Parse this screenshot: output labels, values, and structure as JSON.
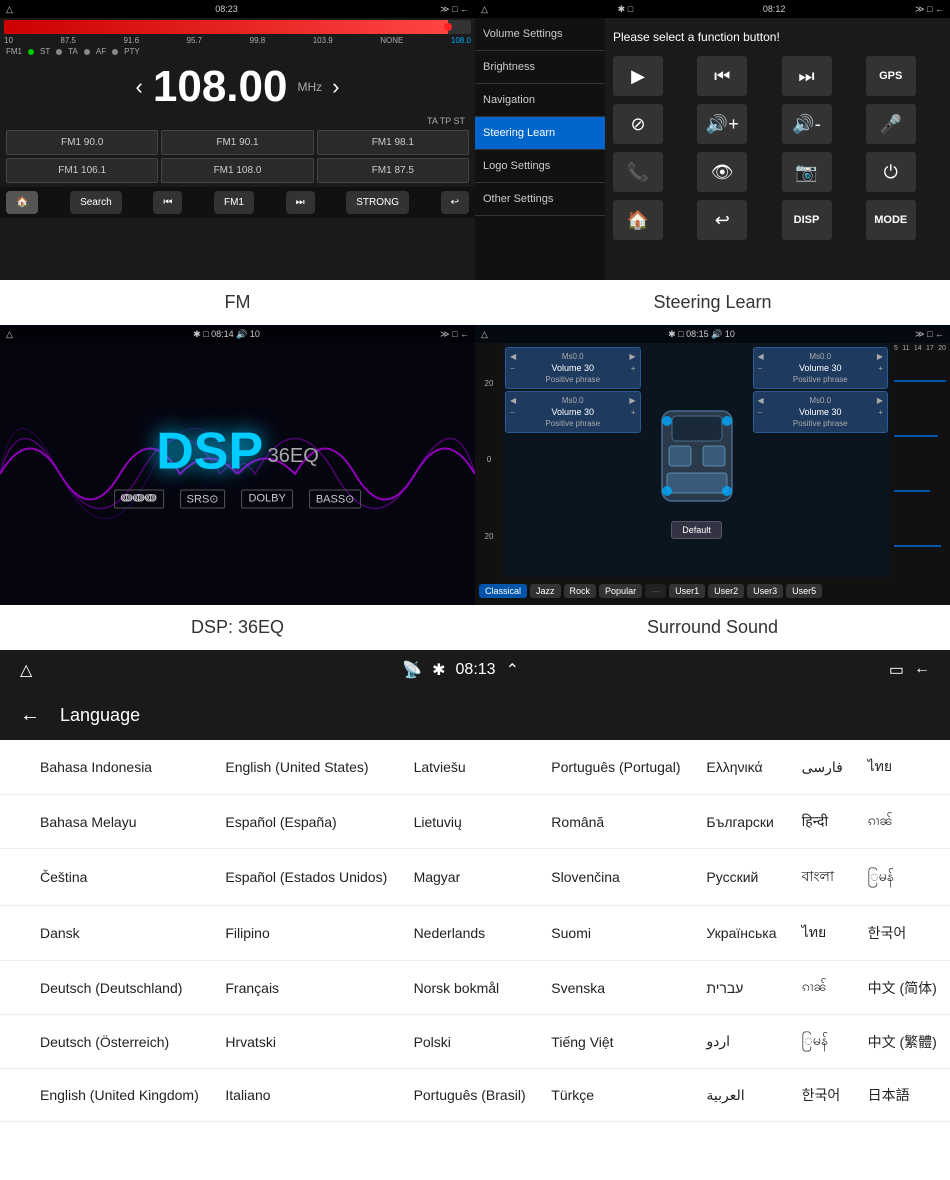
{
  "fm": {
    "status_bar": {
      "left": "△",
      "time": "08:23",
      "icons": "≫ □ ←"
    },
    "progress": 95,
    "scale": [
      "10",
      "87.5",
      "91.6",
      "95.7",
      "99.8",
      "103.9",
      "NONE",
      "108.0"
    ],
    "indicators": [
      "ST",
      "TA",
      "AF",
      "PTY"
    ],
    "fm_label": "FM1",
    "frequency": "108.00",
    "unit": "MHz",
    "ta_tp": "TA  TP  ST",
    "presets": [
      "FM1 90.0",
      "FM1 90.1",
      "FM1 98.1",
      "FM1 106.1",
      "FM1 108.0",
      "FM1 87.5"
    ],
    "buttons": [
      "🏠",
      "Search",
      "⏮",
      "FM1",
      "⏭",
      "STRONG",
      "↩"
    ]
  },
  "steering": {
    "status_bar": {
      "time": "08:12"
    },
    "header_text": "Please select a function button!",
    "sidebar_items": [
      "Volume Settings",
      "Brightness",
      "Navigation",
      "Steering Learn",
      "Logo Settings",
      "Other Settings"
    ],
    "active_sidebar": "Steering Learn",
    "buttons": [
      {
        "icon": "▶",
        "label": "play"
      },
      {
        "icon": "⏮",
        "label": "prev"
      },
      {
        "icon": "⏭",
        "label": "next"
      },
      {
        "icon": "GPS",
        "label": "gps"
      },
      {
        "icon": "⊘",
        "label": "no"
      },
      {
        "icon": "🔊+",
        "label": "vol-up"
      },
      {
        "icon": "🔊-",
        "label": "vol-down"
      },
      {
        "icon": "🎤",
        "label": "mic"
      },
      {
        "icon": "📞",
        "label": "call"
      },
      {
        "icon": "👁",
        "label": "view"
      },
      {
        "icon": "📷",
        "label": "camera"
      },
      {
        "icon": "⏻",
        "label": "power"
      },
      {
        "icon": "🏠",
        "label": "home"
      },
      {
        "icon": "↩",
        "label": "back"
      },
      {
        "icon": "DISP",
        "label": "disp"
      },
      {
        "icon": "MODE",
        "label": "mode"
      }
    ]
  },
  "labels": {
    "fm": "FM",
    "steering_learn": "Steering Learn",
    "dsp": "DSP: 36EQ",
    "surround": "Surround Sound"
  },
  "dsp": {
    "status_bar": {
      "time": "08:14",
      "volume": "10"
    },
    "title": "DSP",
    "subtitle": "36EQ",
    "icons": [
      "ↈↈↈ",
      "SRS⊙",
      "DOLBY",
      "BASS⊙"
    ]
  },
  "surround": {
    "status_bar": {
      "time": "08:15",
      "volume": "10"
    },
    "scale_left": [
      "20",
      "",
      "0",
      "",
      "20"
    ],
    "speakers": [
      {
        "label": "Ms0.0",
        "volume": "Volume 30",
        "phrase": "Positive phrase"
      },
      {
        "label": "Ms0.0",
        "volume": "Volume 30",
        "phrase": "Positive phrase"
      },
      {
        "label": "Ms0.0",
        "volume": "Volume 30",
        "phrase": "Positive phrase"
      },
      {
        "label": "Ms0.0",
        "volume": "Volume 30",
        "phrase": "Positive phrase"
      }
    ],
    "default_btn": "Default",
    "tabs": [
      "Classical",
      "Jazz",
      "Rock",
      "Popular",
      "",
      "User1",
      "User2",
      "User3",
      "User5"
    ]
  },
  "language": {
    "status_bar": {
      "time": "08:13"
    },
    "title": "Language",
    "back": "←",
    "rows": [
      [
        "Bahasa Indonesia",
        "English (United States)",
        "Latviešu",
        "Português (Portugal)",
        "Ελληνικά",
        "فارسی",
        "ไทย"
      ],
      [
        "Bahasa Melayu",
        "Español (España)",
        "Lietuvių",
        "Română",
        "Български",
        "हिन्दी",
        "ၵၢၼ်"
      ],
      [
        "Čeština",
        "Español (Estados Unidos)",
        "Magyar",
        "Slovenčina",
        "Русский",
        "বাংলা",
        "ြမန်"
      ],
      [
        "Dansk",
        "Filipino",
        "Nederlands",
        "Suomi",
        "Українська",
        "ไทย",
        "한국어"
      ],
      [
        "Deutsch (Deutschland)",
        "Français",
        "Norsk bokmål",
        "Svenska",
        "עברית",
        "ၵၢၼ်",
        "中文 (简体)"
      ],
      [
        "Deutsch (Österreich)",
        "Hrvatski",
        "Polski",
        "Tiếng Việt",
        "اردو",
        "ြမန်",
        "中文 (繁體)"
      ],
      [
        "English (United Kingdom)",
        "Italiano",
        "Português (Brasil)",
        "Türkçe",
        "العربية",
        "한국어",
        "日本語"
      ]
    ]
  }
}
